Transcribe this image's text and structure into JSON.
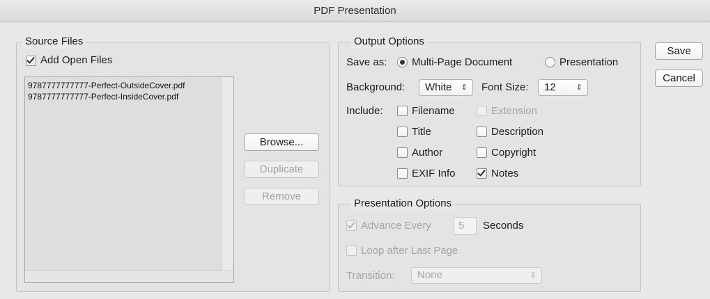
{
  "window": {
    "title": "PDF Presentation"
  },
  "source_files": {
    "group_title": "Source Files",
    "add_open_files": {
      "label": "Add Open Files",
      "checked": true
    },
    "files": [
      "9787777777777-Perfect-OutsideCover.pdf",
      "9787777777777-Perfect-InsideCover.pdf"
    ],
    "buttons": {
      "browse": "Browse...",
      "duplicate": "Duplicate",
      "remove": "Remove"
    }
  },
  "output_options": {
    "group_title": "Output Options",
    "save_as_label": "Save as:",
    "save_as_options": [
      "Multi-Page Document",
      "Presentation"
    ],
    "save_as_selected": "Multi-Page Document",
    "background_label": "Background:",
    "background_value": "White",
    "font_size_label": "Font Size:",
    "font_size_value": "12",
    "include_label": "Include:",
    "include": {
      "filename": {
        "label": "Filename",
        "checked": false,
        "enabled": true
      },
      "extension": {
        "label": "Extension",
        "checked": false,
        "enabled": false
      },
      "title": {
        "label": "Title",
        "checked": false,
        "enabled": true
      },
      "description": {
        "label": "Description",
        "checked": false,
        "enabled": true
      },
      "author": {
        "label": "Author",
        "checked": false,
        "enabled": true
      },
      "copyright": {
        "label": "Copyright",
        "checked": false,
        "enabled": true
      },
      "exif": {
        "label": "EXIF Info",
        "checked": false,
        "enabled": true
      },
      "notes": {
        "label": "Notes",
        "checked": true,
        "enabled": true
      }
    }
  },
  "presentation_options": {
    "group_title": "Presentation Options",
    "advance_every": {
      "label": "Advance Every",
      "checked": true,
      "enabled": false
    },
    "seconds_value": "5",
    "seconds_label": "Seconds",
    "loop": {
      "label": "Loop after Last Page",
      "checked": false,
      "enabled": false
    },
    "transition_label": "Transition:",
    "transition_value": "None"
  },
  "actions": {
    "save": "Save",
    "cancel": "Cancel"
  },
  "icons": {
    "select_arrows": "⇕ up-down-arrows-icon"
  }
}
